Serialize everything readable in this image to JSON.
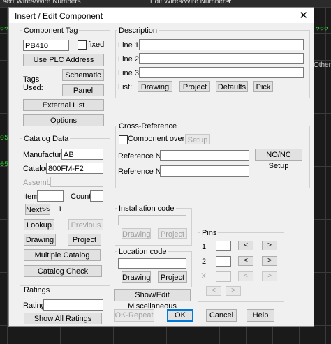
{
  "background": {
    "menu_left": "sert Wires/Wire Numbers",
    "menu_right": "Edit Wires/Wire Numbers",
    "menu_arrow": "▾",
    "side_labels": [
      "???",
      "Other",
      "05",
      "05",
      "Assem"
    ]
  },
  "dialog": {
    "title": "Insert / Edit Component",
    "close": "✕"
  },
  "component_tag": {
    "group_label": "Component Tag",
    "tag_value": "PB410",
    "fixed_label": "fixed",
    "use_plc_label": "Use PLC Address",
    "tags_used_label": "Tags Used:",
    "schematic_label": "Schematic",
    "panel_label": "Panel",
    "external_list_label": "External List",
    "options_label": "Options"
  },
  "description": {
    "group_label": "Description",
    "line1_label": "Line 1",
    "line2_label": "Line 2",
    "line3_label": "Line 3",
    "line1_value": "",
    "line2_value": "",
    "line3_value": "",
    "list_label": "List:",
    "drawing_label": "Drawing",
    "project_label": "Project",
    "defaults_label": "Defaults",
    "pick_label": "Pick"
  },
  "cross_reference": {
    "group_label": "Cross-Reference",
    "override_label": "Component override",
    "setup_label": "Setup",
    "ref_no_label": "Reference NO",
    "ref_nc_label": "Reference NC",
    "ref_no_value": "",
    "ref_nc_value": "",
    "nonc_setup_label": "NO/NC Setup"
  },
  "catalog": {
    "group_label": "Catalog Data",
    "manufacturer_label": "Manufacturer",
    "manufacturer_value": "AB",
    "catalog_label": "Catalog",
    "catalog_value": "800FM-F2",
    "assembly_label": "Assembly",
    "item_label": "Item",
    "count_label": "Count",
    "next_label": "Next>>",
    "next_value": "1",
    "lookup_label": "Lookup",
    "previous_label": "Previous",
    "drawing_label": "Drawing",
    "project_label": "Project",
    "multiple_catalog_label": "Multiple Catalog",
    "catalog_check_label": "Catalog Check"
  },
  "installation": {
    "group_label": "Installation code",
    "drawing_label": "Drawing",
    "project_label": "Project"
  },
  "location": {
    "group_label": "Location code",
    "drawing_label": "Drawing",
    "project_label": "Project"
  },
  "pins": {
    "group_label": "Pins",
    "pin1_label": "1",
    "pin2_label": "2",
    "pin3_label": "X",
    "prev_glyph": "<",
    "next_glyph": ">"
  },
  "ratings": {
    "group_label": "Ratings",
    "rating_label": "Rating",
    "show_all_label": "Show All Ratings"
  },
  "footer": {
    "show_edit_misc_label": "Show/Edit Miscellaneous",
    "ok_repeat_label": "OK-Repeat",
    "ok_label": "OK",
    "cancel_label": "Cancel",
    "help_label": "Help"
  }
}
